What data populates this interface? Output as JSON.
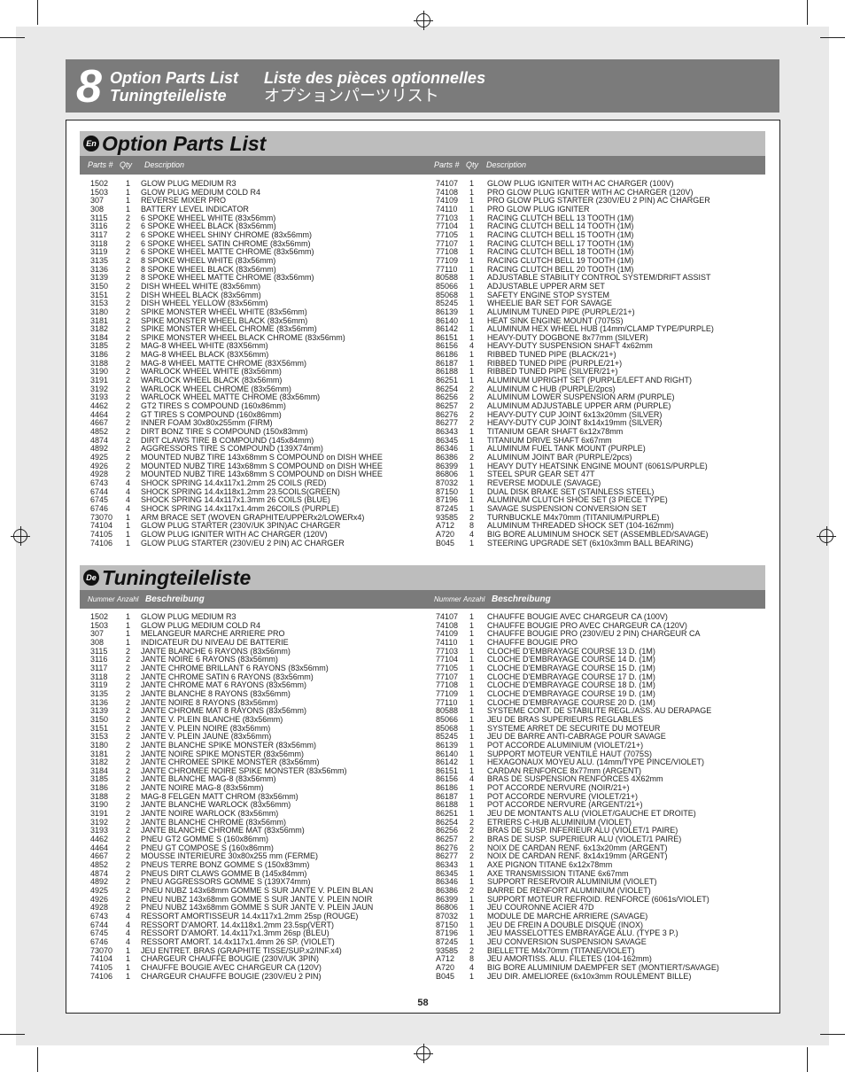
{
  "header": {
    "number": "8",
    "title_en": "Option Parts List",
    "title_de": "Tuningteileliste",
    "title_fr": "Liste des pièces optionnelles",
    "title_jp": "オプションパーツリスト"
  },
  "english": {
    "badge": "En",
    "title": "Option Parts List",
    "columns": {
      "part": "Parts #",
      "qty": "Qty",
      "desc": "Description"
    },
    "left": [
      [
        "1502",
        "1",
        "GLOW PLUG MEDIUM R3"
      ],
      [
        "1503",
        "1",
        "GLOW PLUG MEDIUM COLD R4"
      ],
      [
        "307",
        "1",
        "REVERSE MIXER PRO"
      ],
      [
        "308",
        "1",
        "BATTERY LEVEL INDICATOR"
      ],
      [
        "3115",
        "2",
        "6 SPOKE WHEEL WHITE (83x56mm)"
      ],
      [
        "3116",
        "2",
        "6 SPOKE WHEEL BLACK (83x56mm)"
      ],
      [
        "3117",
        "2",
        "6 SPOKE WHEEL SHINY CHROME (83x56mm)"
      ],
      [
        "3118",
        "2",
        "6 SPOKE WHEEL SATIN CHROME (83x56mm)"
      ],
      [
        "3119",
        "2",
        "6 SPOKE WHEEL MATTE CHROME (83x56mm)"
      ],
      [
        "3135",
        "2",
        "8 SPOKE WHEEL WHITE (83x56mm)"
      ],
      [
        "3136",
        "2",
        "8 SPOKE WHEEL BLACK (83x56mm)"
      ],
      [
        "3139",
        "2",
        "8 SPOKE WHEEL MATTE CHROME (83x56mm)"
      ],
      [
        "3150",
        "2",
        "DISH WHEEL WHITE (83x56mm)"
      ],
      [
        "3151",
        "2",
        "DISH WHEEL BLACK (83x56mm)"
      ],
      [
        "3153",
        "2",
        "DISH WHEEL YELLOW (83x56mm)"
      ],
      [
        "3180",
        "2",
        "SPIKE MONSTER WHEEL WHITE (83x56mm)"
      ],
      [
        "3181",
        "2",
        "SPIKE MONSTER WHEEL BLACK (83x56mm)"
      ],
      [
        "3182",
        "2",
        "SPIKE MONSTER WHEEL CHROME (83x56mm)"
      ],
      [
        "3184",
        "2",
        "SPIKE MONSTER WHEEL BLACK CHROME (83x56mm)"
      ],
      [
        "3185",
        "2",
        "MAG-8 WHEEL WHITE (83X56mm)"
      ],
      [
        "3186",
        "2",
        "MAG-8 WHEEL BLACK (83X56mm)"
      ],
      [
        "3188",
        "2",
        "MAG-8 WHEEL MATTE CHROME (83X56mm)"
      ],
      [
        "3190",
        "2",
        "WARLOCK WHEEL WHITE (83x56mm)"
      ],
      [
        "3191",
        "2",
        "WARLOCK WHEEL BLACK (83x56mm)"
      ],
      [
        "3192",
        "2",
        "WARLOCK WHEEL CHROME (83x56mm)"
      ],
      [
        "3193",
        "2",
        "WARLOCK WHEEL MATTE CHROME (83x56mm)"
      ],
      [
        "4462",
        "2",
        "GT2 TIRES S COMPOUND (160x86mm)"
      ],
      [
        "4464",
        "2",
        "GT TIRES S COMPOUND (160x86mm)"
      ],
      [
        "4667",
        "2",
        "INNER FOAM 30x80x255mm (FIRM)"
      ],
      [
        "4852",
        "2",
        "DIRT BONZ TIRE S COMPOUND (150x83mm)"
      ],
      [
        "4874",
        "2",
        "DIRT CLAWS TIRE B COMPOUND (145x84mm)"
      ],
      [
        "4892",
        "2",
        "AGGRESSORS TIRE S COMPOUND (139X74mm)"
      ],
      [
        "4925",
        "2",
        "MOUNTED NUBZ TIRE 143x68mm S COMPOUND on DISH WHEE"
      ],
      [
        "4926",
        "2",
        "MOUNTED NUBZ TIRE 143x68mm S COMPOUND on DISH WHEE"
      ],
      [
        "4928",
        "2",
        "MOUNTED NUBZ TIRE 143x68mm S COMPOUND on DISH WHEE"
      ],
      [
        "6743",
        "4",
        "SHOCK SPRING 14.4x117x1.2mm 25 COILS (RED)"
      ],
      [
        "6744",
        "4",
        "SHOCK SPRING 14.4x118x1.2mm 23.5COILS(GREEN)"
      ],
      [
        "6745",
        "4",
        "SHOCK SPRING 14.4x117x1.3mm 26 COILS (BLUE)"
      ],
      [
        "6746",
        "4",
        "SHOCK SPRING 14.4x117x1.4mm  26COILS (PURPLE)"
      ],
      [
        "73070",
        "1",
        "ARM BRACE SET (WOVEN GRAPHITE/UPPERx2/LOWERx4)"
      ],
      [
        "74104",
        "1",
        "GLOW PLUG STARTER (230V/UK 3PIN)AC CHARGER"
      ],
      [
        "74105",
        "1",
        "GLOW PLUG IGNITER WITH AC CHARGER (120V)"
      ],
      [
        "74106",
        "1",
        "GLOW PLUG STARTER (230V/EU 2 PIN) AC CHARGER"
      ]
    ],
    "right": [
      [
        "74107",
        "1",
        "GLOW PLUG IGNITER WITH AC CHARGER (100V)"
      ],
      [
        "74108",
        "1",
        "PRO GLOW PLUG IGNITER WITH AC CHARGER (120V)"
      ],
      [
        "74109",
        "1",
        "PRO GLOW PLUG STARTER (230V/EU 2 PIN) AC CHARGER"
      ],
      [
        "74110",
        "1",
        "PRO GLOW PLUG IGNITER"
      ],
      [
        "77103",
        "1",
        "RACING CLUTCH BELL 13 TOOTH (1M)"
      ],
      [
        "77104",
        "1",
        "RACING CLUTCH BELL 14 TOOTH (1M)"
      ],
      [
        "77105",
        "1",
        "RACING CLUTCH BELL 15 TOOTH (1M)"
      ],
      [
        "77107",
        "1",
        "RACING CLUTCH BELL 17 TOOTH (1M)"
      ],
      [
        "77108",
        "1",
        "RACING CLUTCH BELL 18 TOOTH (1M)"
      ],
      [
        "77109",
        "1",
        "RACING CLUTCH BELL 19 TOOTH (1M)"
      ],
      [
        "77110",
        "1",
        "RACING CLUTCH BELL 20 TOOTH (1M)"
      ],
      [
        "80588",
        "1",
        "ADJUSTABLE STABILITY CONTROL SYSTEM/DRIFT ASSIST"
      ],
      [
        "85066",
        "1",
        "ADJUSTABLE UPPER ARM SET"
      ],
      [
        "85068",
        "1",
        "SAFETY ENGINE STOP SYSTEM"
      ],
      [
        "85245",
        "1",
        "WHEELIE BAR SET FOR SAVAGE"
      ],
      [
        "86139",
        "1",
        "ALUMINUM TUNED PIPE (PURPLE/21+)"
      ],
      [
        "86140",
        "1",
        "HEAT SINK ENGINE MOUNT (7075S)"
      ],
      [
        "86142",
        "1",
        "ALUMINUM HEX WHEEL HUB (14mm/CLAMP TYPE/PURPLE)"
      ],
      [
        "86151",
        "1",
        "HEAVY-DUTY DOGBONE 8x77mm (SILVER)"
      ],
      [
        "86156",
        "4",
        "HEAVY-DUTY SUSPENSION SHAFT 4x62mm"
      ],
      [
        "86186",
        "1",
        "RIBBED TUNED PIPE (BLACK/21+)"
      ],
      [
        "86187",
        "1",
        "RIBBED TUNED PIPE (PURPLE/21+)"
      ],
      [
        "86188",
        "1",
        "RIBBED TUNED PIPE (SILVER/21+)"
      ],
      [
        "86251",
        "1",
        "ALUMINUM UPRIGHT SET (PURPLE/LEFT AND RIGHT)"
      ],
      [
        "86254",
        "2",
        "ALUMINUM C HUB (PURPLE/2pcs)"
      ],
      [
        "86256",
        "2",
        "ALUMINUM LOWER SUSPENSION ARM (PURPLE)"
      ],
      [
        "86257",
        "2",
        "ALUMINUM ADJUSTABLE UPPER ARM (PURPLE)"
      ],
      [
        "86276",
        "2",
        "HEAVY-DUTY CUP JOINT 6x13x20mm (SILVER)"
      ],
      [
        "86277",
        "2",
        "HEAVY-DUTY CUP JOINT 8x14x19mm (SILVER)"
      ],
      [
        "86343",
        "1",
        "TITANIUM GEAR SHAFT 6x12x78mm"
      ],
      [
        "86345",
        "1",
        "TITANIUM DRIVE SHAFT 6x67mm"
      ],
      [
        "86346",
        "1",
        "ALUMINUM FUEL TANK MOUNT (PURPLE)"
      ],
      [
        "86386",
        "2",
        "ALUMINUM JOINT BAR (PURPLE/2pcs)"
      ],
      [
        "86399",
        "1",
        "HEAVY DUTY HEATSINK ENGINE MOUNT (6061S/PURPLE)"
      ],
      [
        "86806",
        "1",
        "STEEL SPUR GEAR SET 47T"
      ],
      [
        "87032",
        "1",
        "REVERSE MODULE (SAVAGE)"
      ],
      [
        "87150",
        "1",
        "DUAL DISK BRAKE SET (STAINLESS STEEL)"
      ],
      [
        "87196",
        "1",
        "ALUMINUM CLUTCH SHOE SET (3 PIECE TYPE)"
      ],
      [
        "87245",
        "1",
        "SAVAGE SUSPENSION CONVERSION SET"
      ],
      [
        "93585",
        "2",
        "TURNBUCKLE M4x70mm (TITANIUM/PURPLE)"
      ],
      [
        "A712",
        "8",
        "ALUMINUM THREADED SHOCK SET (104-162mm)"
      ],
      [
        "A720",
        "4",
        "BIG BORE ALUMINUM SHOCK SET (ASSEMBLED/SAVAGE)"
      ],
      [
        "B045",
        "1",
        "STEERING UPGRADE SET (6x10x3mm BALL BEARING)"
      ]
    ]
  },
  "german": {
    "badge": "De",
    "title": "Tuningteileliste",
    "columns": {
      "part": "Nummer",
      "qty": "Anzahl",
      "desc": "Beschreibung"
    },
    "left": [
      [
        "1502",
        "1",
        "GLOW PLUG MEDIUM R3"
      ],
      [
        "1503",
        "1",
        "GLOW PLUG MEDIUM COLD R4"
      ],
      [
        "307",
        "1",
        "MELANGEUR MARCHE ARRIERE PRO"
      ],
      [
        "308",
        "1",
        "INDICATEUR DU NIVEAU DE BATTERIE"
      ],
      [
        "3115",
        "2",
        "JANTE BLANCHE 6 RAYONS (83x56mm)"
      ],
      [
        "3116",
        "2",
        "JANTE NOIRE 6 RAYONS (83x56mm)"
      ],
      [
        "3117",
        "2",
        "JANTE CHROME BRILLANT 6 RAYONS (83x56mm)"
      ],
      [
        "3118",
        "2",
        "JANTE CHROME SATIN 6 RAYONS (83x56mm)"
      ],
      [
        "3119",
        "2",
        "JANTE CHROME MAT 6 RAYONS (83x56mm)"
      ],
      [
        "3135",
        "2",
        "JANTE BLANCHE 8 RAYONS (83x56mm)"
      ],
      [
        "3136",
        "2",
        "JANTE NOIRE 8 RAYONS (83x56mm)"
      ],
      [
        "3139",
        "2",
        "JANTE CHROME MAT 8 RAYONS (83x56mm)"
      ],
      [
        "3150",
        "2",
        "JANTE V. PLEIN BLANCHE (83x56mm)"
      ],
      [
        "3151",
        "2",
        "JANTE V. PLEIN NOIRE (83x56mm)"
      ],
      [
        "3153",
        "2",
        "JANTE V. PLEIN JAUNE (83x56mm)"
      ],
      [
        "3180",
        "2",
        "JANTE BLANCHE SPIKE MONSTER (83x56mm)"
      ],
      [
        "3181",
        "2",
        "JANTE NOIRE SPIKE MONSTER (83x56mm)"
      ],
      [
        "3182",
        "2",
        "JANTE CHROMEE SPIKE MONSTER (83x56mm)"
      ],
      [
        "3184",
        "2",
        "JANTE CHROMEE NOIRE SPIKE MONSTER (83x56mm)"
      ],
      [
        "3185",
        "2",
        "JANTE BLANCHE MAG-8 (83x56mm)"
      ],
      [
        "3186",
        "2",
        "JANTE NOIRE MAG-8 (83x56mm)"
      ],
      [
        "3188",
        "2",
        "MAG-8 FELGEN MATT CHROM (83x56mm)"
      ],
      [
        "3190",
        "2",
        "JANTE BLANCHE WARLOCK (83x56mm)"
      ],
      [
        "3191",
        "2",
        "JANTE NOIRE WARLOCK (83x56mm)"
      ],
      [
        "3192",
        "2",
        "JANTE BLANCHE CHROME (83x56mm)"
      ],
      [
        "3193",
        "2",
        "JANTE BLANCHE CHROME MAT (83x56mm)"
      ],
      [
        "4462",
        "2",
        "PNEU GT2 GOMME S (160x86mm)"
      ],
      [
        "4464",
        "2",
        "PNEU GT COMPOSE S (160x86mm)"
      ],
      [
        "4667",
        "2",
        "MOUSSE INTERIEURE 30x80x255 mm (FERME)"
      ],
      [
        "4852",
        "2",
        "PNEUS TERRE BONZ GOMME S (150x83mm)"
      ],
      [
        "4874",
        "2",
        "PNEUS DIRT CLAWS GOMME B (145x84mm)"
      ],
      [
        "4892",
        "2",
        "PNEU AGGRESSORS GOMME S (139X74mm)"
      ],
      [
        "4925",
        "2",
        "PNEU NUBZ 143x68mm GOMME S SUR JANTE V. PLEIN BLAN"
      ],
      [
        "4926",
        "2",
        "PNEU NUBZ 143x68mm GOMME S SUR JANTE V. PLEIN NOIR"
      ],
      [
        "4928",
        "2",
        "PNEU NUBZ 143x68mm GOMME S SUR JANTE V. PLEIN JAUN"
      ],
      [
        "6743",
        "4",
        "RESSORT AMORTISSEUR 14.4x117x1.2mm 25sp (ROUGE)"
      ],
      [
        "6744",
        "4",
        "RESSORT D'AMORT. 14.4x118x1.2mm 23.5sp(VERT)"
      ],
      [
        "6745",
        "4",
        "RESSORT D'AMORT. 14.4x117x1.3mm 26sp (BLEU)"
      ],
      [
        "6746",
        "4",
        "RESSORT AMORT. 14.4x117x1.4mm 26 SP. (VIOLET)"
      ],
      [
        "73070",
        "1",
        "JEU ENTRET. BRAS (GRAPHITE TISSE/SUP.x2/INF.x4)"
      ],
      [
        "74104",
        "1",
        "CHARGEUR CHAUFFE BOUGIE (230V/UK 3PIN)"
      ],
      [
        "74105",
        "1",
        "CHAUFFE BOUGIE AVEC CHARGEUR CA  (120V)"
      ],
      [
        "74106",
        "1",
        "CHARGEUR CHAUFFE BOUGIE (230V/EU 2 PIN)"
      ]
    ],
    "right": [
      [
        "74107",
        "1",
        "CHAUFFE BOUGIE AVEC CHARGEUR CA (100V)"
      ],
      [
        "74108",
        "1",
        "CHAUFFE BOUGIE PRO AVEC CHARGEUR CA (120V)"
      ],
      [
        "74109",
        "1",
        "CHAUFFE BOUGIE PRO (230V/EU 2 PIN) CHARGEUR CA"
      ],
      [
        "74110",
        "1",
        "CHAUFFE BOUGIE PRO"
      ],
      [
        "77103",
        "1",
        "CLOCHE D'EMBRAYAGE COURSE 13 D. (1M)"
      ],
      [
        "77104",
        "1",
        "CLOCHE D'EMBRAYAGE COURSE 14 D. (1M)"
      ],
      [
        "77105",
        "1",
        "CLOCHE D'EMBRAYAGE COURSE 15 D. (1M)"
      ],
      [
        "77107",
        "1",
        "CLOCHE D'EMBRAYAGE COURSE 17 D. (1M)"
      ],
      [
        "77108",
        "1",
        "CLOCHE D'EMBRAYAGE COURSE 18 D. (1M)"
      ],
      [
        "77109",
        "1",
        "CLOCHE D'EMBRAYAGE COURSE 19 D. (1M)"
      ],
      [
        "77110",
        "1",
        "CLOCHE D'EMBRAYAGE COURSE 20 D. (1M)"
      ],
      [
        "80588",
        "1",
        "SYSTEME CONT. DE STABILITE REGL./ASS. AU DERAPAGE"
      ],
      [
        "85066",
        "1",
        "JEU DE BRAS SUPERIEURS REGLABLES"
      ],
      [
        "85068",
        "1",
        "SYSTEME ARRET DE SECURITE DU MOTEUR"
      ],
      [
        "85245",
        "1",
        "JEU DE BARRE ANTI-CABRAGE POUR SAVAGE"
      ],
      [
        "86139",
        "1",
        "POT ACCORDE ALUMINIUM (VIOLET/21+)"
      ],
      [
        "86140",
        "1",
        "SUPPORT MOTEUR VENTILE HAUT (7075S)"
      ],
      [
        "86142",
        "1",
        "HEXAGONAUX MOYEU ALU. (14mm/TYPE PINCE/VIOLET)"
      ],
      [
        "86151",
        "1",
        "CARDAN RENFORCE 8x77mm (ARGENT)"
      ],
      [
        "86156",
        "4",
        "BRAS DE SUSPENSION RENFORCES 4X62mm"
      ],
      [
        "86186",
        "1",
        "POT ACCORDE NERVURE (NOIR/21+)"
      ],
      [
        "86187",
        "1",
        "POT ACCORDE NERVURE (VIOLET/21+)"
      ],
      [
        "86188",
        "1",
        "POT ACCORDE NERVURE (ARGENT/21+)"
      ],
      [
        "86251",
        "1",
        "JEU DE MONTANTS ALU (VIOLET/GAUCHE ET DROITE)"
      ],
      [
        "86254",
        "2",
        "ETRIERS C-HUB ALUMINIUM (VIOLET)"
      ],
      [
        "86256",
        "2",
        "BRAS DE SUSP. INFERIEUR ALU (VIOLET/1 PAIRE)"
      ],
      [
        "86257",
        "2",
        "BRAS DE SUSP. SUPERIEUR ALU (VIOLET/1 PAIRE)"
      ],
      [
        "86276",
        "2",
        "NOIX DE CARDAN RENF. 6x13x20mm (ARGENT)"
      ],
      [
        "86277",
        "2",
        "NOIX DE CARDAN RENF. 8x14x19mm (ARGENT)"
      ],
      [
        "86343",
        "1",
        "AXE PIGNON TITANE 6x12x78mm"
      ],
      [
        "86345",
        "1",
        "AXE TRANSMISSION TITANE 6x67mm"
      ],
      [
        "86346",
        "1",
        "SUPPORT RESERVOIR ALUMINIUM (VIOLET)"
      ],
      [
        "86386",
        "2",
        "BARRE DE RENFORT ALUMINIUM (VIOLET)"
      ],
      [
        "86399",
        "1",
        "SUPPORT MOTEUR REFROID. RENFORCE (6061s/VIOLET)"
      ],
      [
        "86806",
        "1",
        "JEU COURONNE ACIER 47D"
      ],
      [
        "87032",
        "1",
        "MODULE DE MARCHE ARRIERE (SAVAGE)"
      ],
      [
        "87150",
        "1",
        "JEU DE FREIN A DOUBLE DISQUE (INOX)"
      ],
      [
        "87196",
        "1",
        "JEU MASSELOTTES EMBRAYAGE ALU. (TYPE 3 P.)"
      ],
      [
        "87245",
        "1",
        "JEU CONVERSION SUSPENSION SAVAGE"
      ],
      [
        "93585",
        "2",
        "BIELLETTE M4x70mm (TITANE/VIOLET)"
      ],
      [
        "A712",
        "8",
        "JEU AMORTISS. ALU. FILETES (104-162mm)"
      ],
      [
        "A720",
        "4",
        "BIG BORE ALUMINIUM DAEMPFER SET (MONTIERT/SAVAGE)"
      ],
      [
        "B045",
        "1",
        "JEU DIR. AMELIOREE (6x10x3mm ROULEMENT BILLE)"
      ]
    ]
  },
  "page_number": "58",
  "colors": {
    "header_bar": "#7b7b7b",
    "section_bar": "#bdbdbd",
    "column_bar": "#7b7b7b",
    "sheet": "#e9e9e9"
  }
}
